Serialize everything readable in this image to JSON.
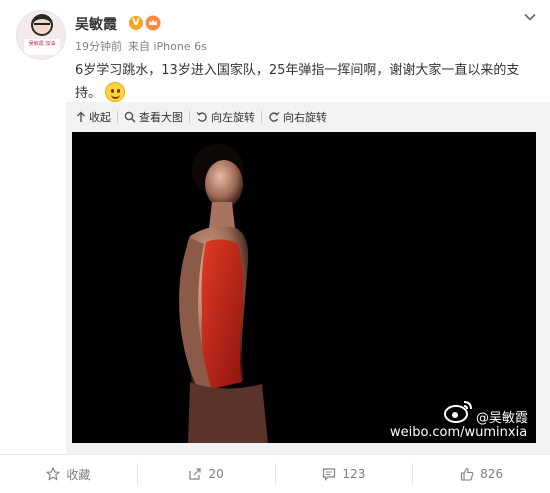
{
  "post": {
    "author": "吴敏霞",
    "verified_badge": "V",
    "avatar_sign_text": "吴敏霞\n加油",
    "time": "19分钟前",
    "source": "来自 iPhone 6s",
    "text": "6岁学习跳水，13岁进入国家队，25年弹指一挥间啊，谢谢大家一直以来的支持。",
    "emoji_icon": "smile-emoji-icon"
  },
  "media_toolbar": {
    "collapse": "收起",
    "view_large": "查看大图",
    "rotate_left": "向左旋转",
    "rotate_right": "向右旋转"
  },
  "watermark": {
    "name": "@吴敏霞",
    "url": "weibo.com/wuminxia"
  },
  "actions": {
    "favorite": "收藏",
    "repost": "20",
    "comment": "123",
    "like": "826"
  },
  "colors": {
    "swimsuit": "#c8251a",
    "verified": "#f5a623",
    "text": "#333333",
    "muted": "#808080",
    "toolbar_bg": "#f2f2f5"
  }
}
